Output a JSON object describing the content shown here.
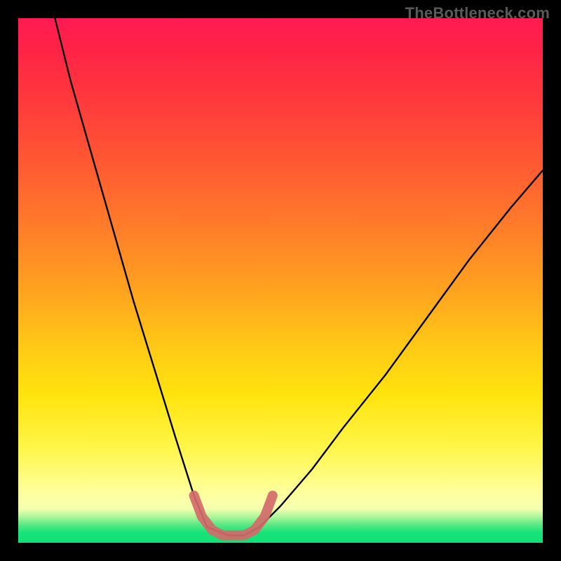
{
  "watermark": {
    "text": "TheBottleneck.com"
  },
  "chart_data": {
    "type": "line",
    "title": "",
    "xlabel": "",
    "ylabel": "",
    "xlim": [
      0,
      100
    ],
    "ylim": [
      0,
      100
    ],
    "grid": false,
    "legend": false,
    "series": [
      {
        "name": "left-branch",
        "color": "#000000",
        "x": [
          7,
          10,
          14,
          18,
          22,
          26,
          30,
          33.5,
          36
        ],
        "y": [
          100,
          88,
          74,
          60,
          46,
          33,
          20,
          9,
          3
        ]
      },
      {
        "name": "right-branch",
        "color": "#000000",
        "x": [
          46,
          50,
          56,
          62,
          70,
          78,
          86,
          94,
          100
        ],
        "y": [
          3,
          7,
          14,
          22,
          32,
          43,
          54,
          64,
          71
        ]
      },
      {
        "name": "valley-floor",
        "color": "#000000",
        "x": [
          36,
          40,
          43,
          46
        ],
        "y": [
          3,
          1.4,
          1.4,
          3
        ]
      },
      {
        "name": "valley-marker",
        "color": "#d46a6a",
        "x": [
          33.5,
          35,
          37,
          39,
          41,
          43,
          45,
          47,
          48.5
        ],
        "y": [
          9,
          5,
          2.4,
          1.4,
          1.4,
          1.4,
          2.4,
          5,
          9
        ]
      }
    ],
    "background_gradient": {
      "top": "#ff1b53",
      "mid": "#ffe40e",
      "bottom": "#0ee176"
    }
  }
}
